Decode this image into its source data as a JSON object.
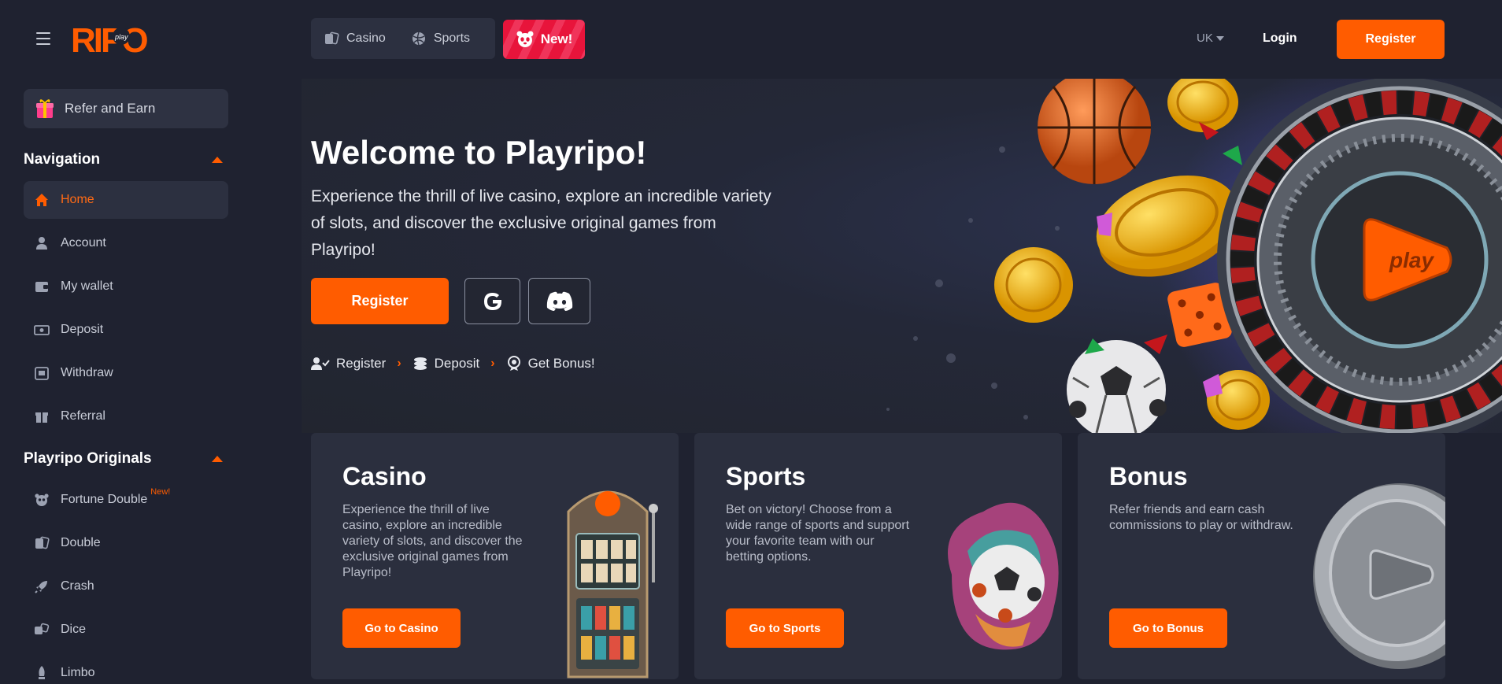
{
  "header": {
    "logo_text": "RIPO",
    "logo_badge": "play",
    "tabs": [
      {
        "label": "Casino",
        "icon": "cards-icon"
      },
      {
        "label": "Sports",
        "icon": "ball-icon"
      }
    ],
    "new_label": "New!",
    "language": "UK",
    "login_label": "Login",
    "register_label": "Register"
  },
  "sidebar": {
    "refer_label": "Refer and Earn",
    "navigation_title": "Navigation",
    "nav_items": [
      {
        "label": "Home",
        "icon": "home-icon",
        "active": true
      },
      {
        "label": "Account",
        "icon": "user-icon"
      },
      {
        "label": "My wallet",
        "icon": "wallet-icon"
      },
      {
        "label": "Deposit",
        "icon": "cash-icon"
      },
      {
        "label": "Withdraw",
        "icon": "atm-icon"
      },
      {
        "label": "Referral",
        "icon": "gift-icon"
      }
    ],
    "originals_title": "Playripo Originals",
    "originals_items": [
      {
        "label": "Fortune Double",
        "icon": "panda-icon",
        "tag": "New!"
      },
      {
        "label": "Double",
        "icon": "cards-icon"
      },
      {
        "label": "Crash",
        "icon": "rocket-icon"
      },
      {
        "label": "Dice",
        "icon": "dice-icon"
      },
      {
        "label": "Limbo",
        "icon": "limbo-icon"
      }
    ]
  },
  "hero": {
    "title": "Welcome to Playripo!",
    "text": "Experience the thrill of live casino, explore an incredible variety of slots, and discover the exclusive original games from Playripo!",
    "register_label": "Register",
    "steps": [
      {
        "label": "Register",
        "icon": "user-check-icon"
      },
      {
        "label": "Deposit",
        "icon": "coins-icon"
      },
      {
        "label": "Get Bonus!",
        "icon": "bonus-icon"
      }
    ],
    "roulette_badge": "play"
  },
  "cards": [
    {
      "title": "Casino",
      "text": "Experience the thrill of live casino, explore an incredible variety of slots, and discover the exclusive original games from Playripo!",
      "button": "Go to Casino"
    },
    {
      "title": "Sports",
      "text": "Bet on victory! Choose from a wide range of sports and support your favorite team with our betting options.",
      "button": "Go to Sports"
    },
    {
      "title": "Bonus",
      "text": "Refer friends and earn cash commissions to play or withdraw.",
      "button": "Go to Bonus"
    }
  ],
  "colors": {
    "background": "#1f2230",
    "accent": "#ff5c00",
    "new_badge": "#e8143b",
    "panel": "#2b2f3e"
  }
}
